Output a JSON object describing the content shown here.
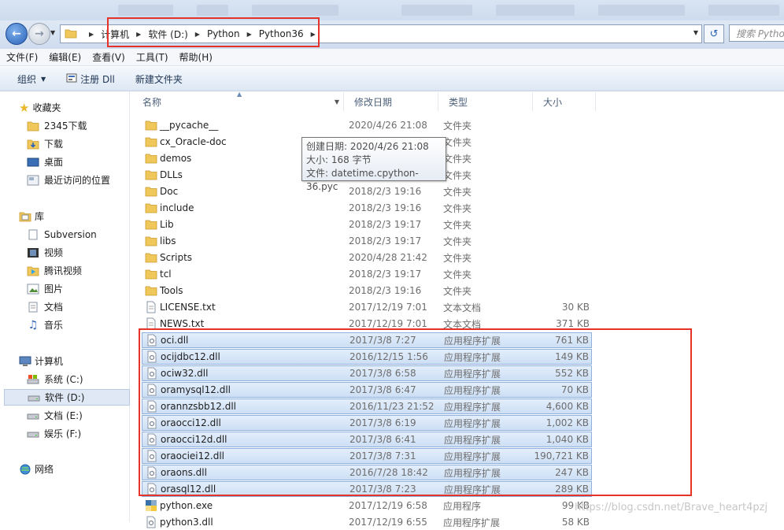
{
  "address": {
    "breadcrumbs": [
      "计算机",
      "软件 (D:)",
      "Python",
      "Python36"
    ],
    "search_placeholder": "搜索 Pytho"
  },
  "menu": [
    "文件(F)",
    "编辑(E)",
    "查看(V)",
    "工具(T)",
    "帮助(H)"
  ],
  "toolbar": {
    "organize": "组织",
    "register_dll": "注册 Dll",
    "new_folder": "新建文件夹"
  },
  "nav": {
    "favorites": "收藏夹",
    "favorites_items": [
      "2345下载",
      "下载",
      "桌面",
      "最近访问的位置"
    ],
    "libraries": "库",
    "library_items": [
      "Subversion",
      "视频",
      "腾讯视频",
      "图片",
      "文档",
      "音乐"
    ],
    "computer": "计算机",
    "drives": [
      "系统 (C:)",
      "软件 (D:)",
      "文档 (E:)",
      "娱乐 (F:)"
    ],
    "network": "网络"
  },
  "columns": {
    "name": "名称",
    "date": "修改日期",
    "type": "类型",
    "size": "大小"
  },
  "files": [
    {
      "name": "__pycache__",
      "date": "2020/4/26 21:08",
      "type": "文件夹",
      "size": "",
      "kind": "folder"
    },
    {
      "name": "cx_Oracle-doc",
      "date": "2020/4/26 21:08",
      "type": "文件夹",
      "size": "",
      "kind": "folder"
    },
    {
      "name": "demos",
      "date": "",
      "type": "文件夹",
      "size": "",
      "kind": "folder"
    },
    {
      "name": "DLLs",
      "date": "",
      "type": "文件夹",
      "size": "",
      "kind": "folder"
    },
    {
      "name": "Doc",
      "date": "2018/2/3 19:16",
      "type": "文件夹",
      "size": "",
      "kind": "folder"
    },
    {
      "name": "include",
      "date": "2018/2/3 19:16",
      "type": "文件夹",
      "size": "",
      "kind": "folder"
    },
    {
      "name": "Lib",
      "date": "2018/2/3 19:17",
      "type": "文件夹",
      "size": "",
      "kind": "folder"
    },
    {
      "name": "libs",
      "date": "2018/2/3 19:17",
      "type": "文件夹",
      "size": "",
      "kind": "folder"
    },
    {
      "name": "Scripts",
      "date": "2020/4/28 21:42",
      "type": "文件夹",
      "size": "",
      "kind": "folder"
    },
    {
      "name": "tcl",
      "date": "2018/2/3 19:17",
      "type": "文件夹",
      "size": "",
      "kind": "folder"
    },
    {
      "name": "Tools",
      "date": "2018/2/3 19:16",
      "type": "文件夹",
      "size": "",
      "kind": "folder"
    },
    {
      "name": "LICENSE.txt",
      "date": "2017/12/19 7:01",
      "type": "文本文档",
      "size": "30 KB",
      "kind": "text"
    },
    {
      "name": "NEWS.txt",
      "date": "2017/12/19 7:01",
      "type": "文本文档",
      "size": "371 KB",
      "kind": "text"
    },
    {
      "name": "oci.dll",
      "date": "2017/3/8 7:27",
      "type": "应用程序扩展",
      "size": "761 KB",
      "kind": "dll",
      "selected": true
    },
    {
      "name": "ocijdbc12.dll",
      "date": "2016/12/15 1:56",
      "type": "应用程序扩展",
      "size": "149 KB",
      "kind": "dll",
      "selected": true
    },
    {
      "name": "ociw32.dll",
      "date": "2017/3/8 6:58",
      "type": "应用程序扩展",
      "size": "552 KB",
      "kind": "dll",
      "selected": true
    },
    {
      "name": "oramysql12.dll",
      "date": "2017/3/8 6:47",
      "type": "应用程序扩展",
      "size": "70 KB",
      "kind": "dll",
      "selected": true
    },
    {
      "name": "orannzsbb12.dll",
      "date": "2016/11/23 21:52",
      "type": "应用程序扩展",
      "size": "4,600 KB",
      "kind": "dll",
      "selected": true
    },
    {
      "name": "oraocci12.dll",
      "date": "2017/3/8 6:19",
      "type": "应用程序扩展",
      "size": "1,002 KB",
      "kind": "dll",
      "selected": true
    },
    {
      "name": "oraocci12d.dll",
      "date": "2017/3/8 6:41",
      "type": "应用程序扩展",
      "size": "1,040 KB",
      "kind": "dll",
      "selected": true
    },
    {
      "name": "oraociei12.dll",
      "date": "2017/3/8 7:31",
      "type": "应用程序扩展",
      "size": "190,721 KB",
      "kind": "dll",
      "selected": true
    },
    {
      "name": "oraons.dll",
      "date": "2016/7/28 18:42",
      "type": "应用程序扩展",
      "size": "247 KB",
      "kind": "dll",
      "selected": true
    },
    {
      "name": "orasql12.dll",
      "date": "2017/3/8 7:23",
      "type": "应用程序扩展",
      "size": "289 KB",
      "kind": "dll",
      "selected": true
    },
    {
      "name": "python.exe",
      "date": "2017/12/19 6:58",
      "type": "应用程序",
      "size": "99 KB",
      "kind": "exe"
    },
    {
      "name": "python3.dll",
      "date": "2017/12/19 6:55",
      "type": "应用程序扩展",
      "size": "58 KB",
      "kind": "dll"
    }
  ],
  "tooltip": {
    "line1": "创建日期: 2020/4/26 21:08",
    "line2": "大小: 168 字节",
    "line3": "文件: datetime.cpython-36.pyc"
  },
  "watermark": "https://blog.csdn.net/Brave_heart4pzj",
  "colors": {
    "selection": "#cddff5",
    "highlight_box": "#e5332a",
    "folder": "#f0c75a"
  }
}
